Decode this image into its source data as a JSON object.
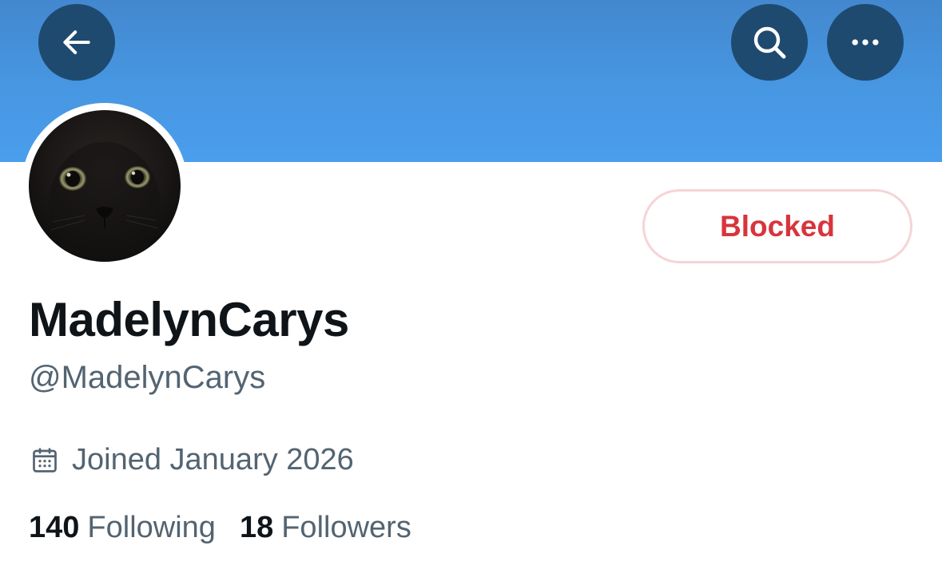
{
  "profile": {
    "display_name": "MadelynCarys",
    "handle": "@MadelynCarys",
    "joined": "Joined January 2026",
    "following_count": "140",
    "following_label": "Following",
    "followers_count": "18",
    "followers_label": "Followers"
  },
  "actions": {
    "blocked_label": "Blocked"
  },
  "icons": {
    "back": "back-arrow-icon",
    "search": "search-icon",
    "more": "more-options-icon",
    "calendar": "calendar-icon"
  },
  "colors": {
    "banner": "#4a9eed",
    "nav_button": "#1f4a70",
    "blocked_text": "#d8343c",
    "blocked_border": "#f5d4d7",
    "primary_text": "#0f1419",
    "secondary_text": "#536471"
  }
}
